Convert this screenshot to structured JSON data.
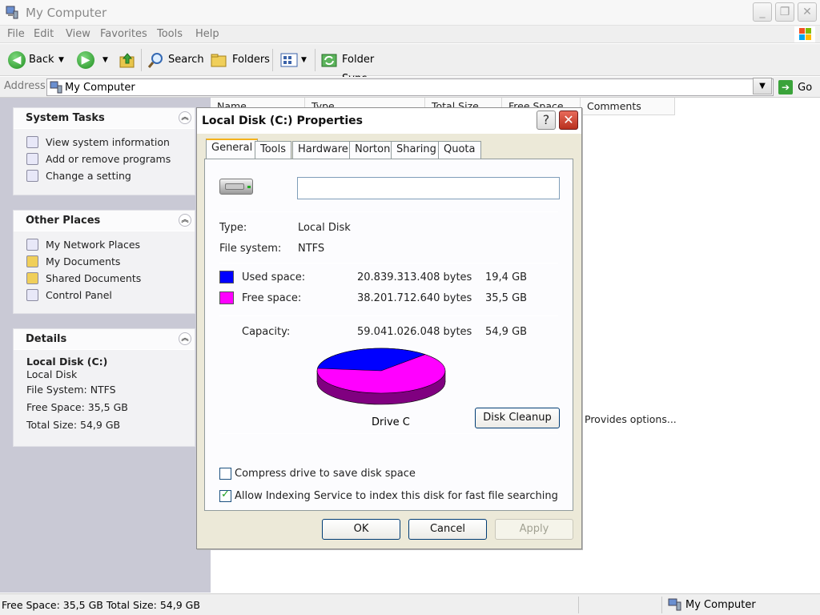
{
  "window": {
    "title": "My Computer",
    "controls": {
      "minimize": "_",
      "restore": "❐",
      "close": "✕"
    }
  },
  "menu": [
    "File",
    "Edit",
    "View",
    "Favorites",
    "Tools",
    "Help"
  ],
  "toolbar": {
    "back": "Back",
    "search": "Search",
    "folders": "Folders",
    "folder_sync": "Folder Sync"
  },
  "address": {
    "label": "Address",
    "value": "My Computer",
    "go": "Go"
  },
  "sidebar": {
    "system_tasks": {
      "title": "System Tasks",
      "items": [
        "View system information",
        "Add or remove programs",
        "Change a setting"
      ]
    },
    "other_places": {
      "title": "Other Places",
      "items": [
        "My Network Places",
        "My Documents",
        "Shared Documents",
        "Control Panel"
      ]
    },
    "details": {
      "title": "Details",
      "name": "Local Disk (C:)",
      "type": "Local Disk",
      "file_system": "File System: NTFS",
      "free_space": "Free Space: 35,5 GB",
      "total_size": "Total Size: 54,9 GB"
    }
  },
  "list": {
    "columns": [
      "Name",
      "Type",
      "Total Size",
      "Free Space",
      "Comments"
    ],
    "comment_cell": "Provides options..."
  },
  "status": {
    "left": "Free Space: 35,5 GB Total Size: 54,9 GB",
    "right": "My Computer"
  },
  "dialog": {
    "title": "Local Disk (C:) Properties",
    "help": "?",
    "close": "✕",
    "tabs": [
      "General",
      "Tools",
      "Hardware",
      "Norton",
      "Sharing",
      "Quota"
    ],
    "active_tab": "General",
    "name_value": "",
    "type_label": "Type:",
    "type_value": "Local Disk",
    "fs_label": "File system:",
    "fs_value": "NTFS",
    "used_label": "Used space:",
    "used_bytes": "20.839.313.408 bytes",
    "used_gb": "19,4 GB",
    "free_label": "Free space:",
    "free_bytes": "38.201.712.640 bytes",
    "free_gb": "35,5 GB",
    "capacity_label": "Capacity:",
    "capacity_bytes": "59.041.026.048 bytes",
    "capacity_gb": "54,9 GB",
    "drive_caption": "Drive C",
    "disk_cleanup": "Disk Cleanup",
    "compress_label": "Compress drive to save disk space",
    "compress_checked": false,
    "index_label": "Allow Indexing Service to index this disk for fast file searching",
    "index_checked": true,
    "ok": "OK",
    "cancel": "Cancel",
    "apply": "Apply",
    "used_color": "#0000ff",
    "free_color": "#ff00ff",
    "used_fraction": 0.353
  }
}
